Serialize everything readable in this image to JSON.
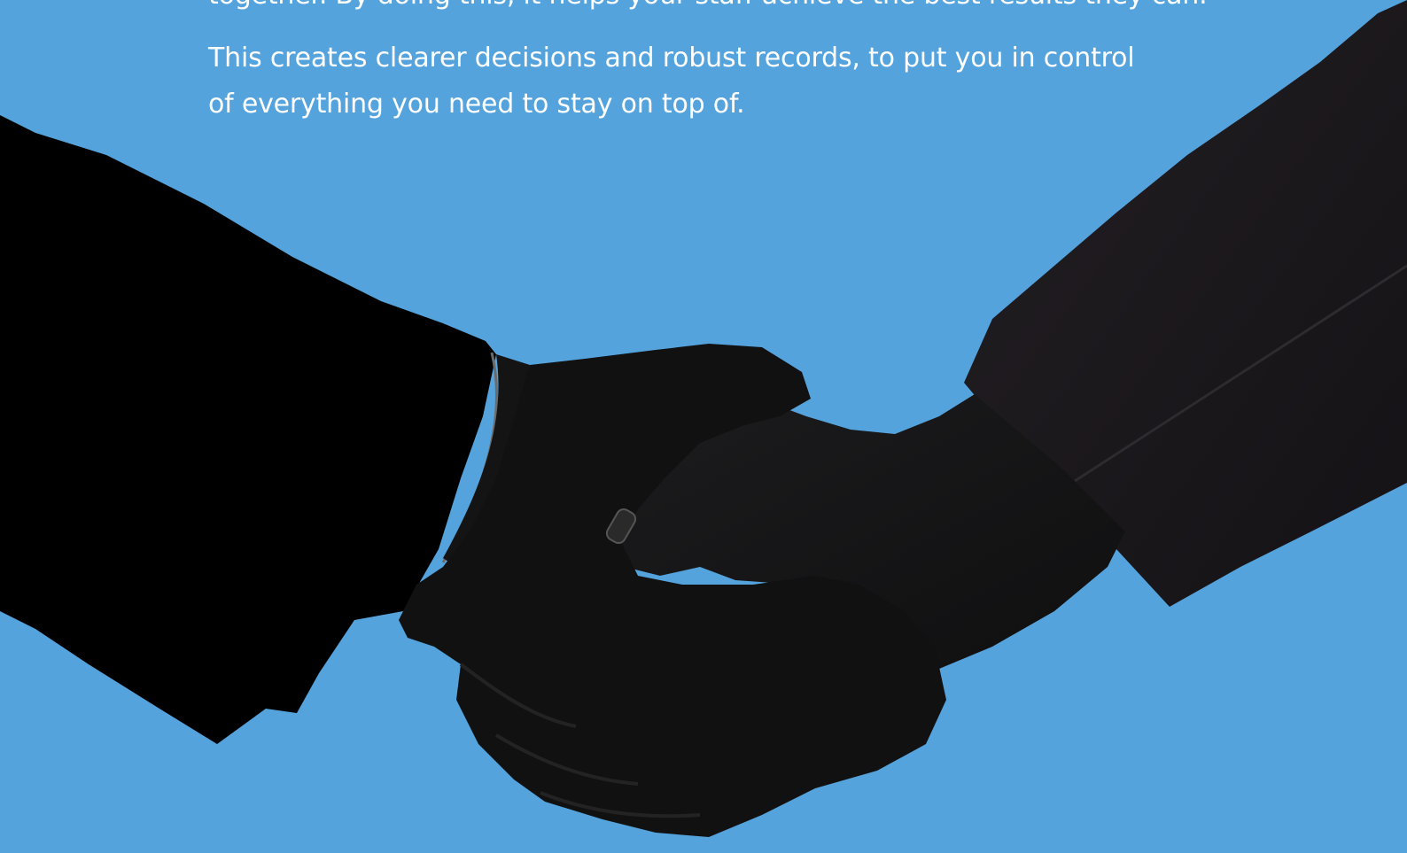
{
  "hero": {
    "partial_paragraph": "together. By doing this, it helps your staff achieve the best results they can.",
    "paragraph": "This creates clearer decisions and robust records, to put you in control of everything you need to stay on top of.",
    "image_subject": "handshake-silhouette",
    "background_color": "#55a3dd"
  }
}
